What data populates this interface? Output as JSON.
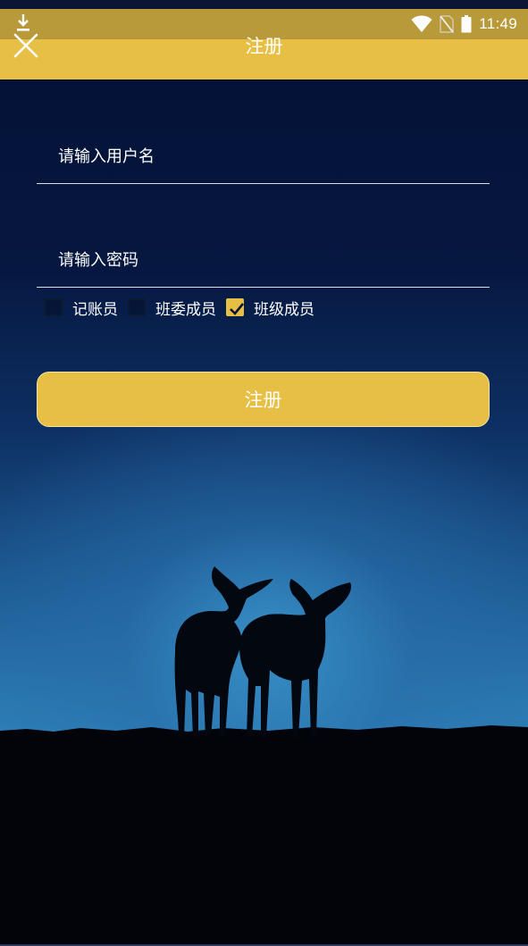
{
  "status_bar": {
    "time": "11:49",
    "icons": [
      "download-icon",
      "wifi-icon",
      "no-sim-icon",
      "battery-icon"
    ]
  },
  "header": {
    "title": "注册",
    "close_icon": "close-icon"
  },
  "form": {
    "username_placeholder": "请输入用户名",
    "password_placeholder": "请输入密码",
    "roles": [
      {
        "label": "记账员",
        "checked": false
      },
      {
        "label": "班委成员",
        "checked": false
      },
      {
        "label": "班级成员",
        "checked": true
      }
    ],
    "submit_label": "注册"
  },
  "colors": {
    "accent": "#e8bf45",
    "status_bar": "#b99a3a",
    "background_top": "#041033",
    "background_glow": "#2f80b8"
  }
}
